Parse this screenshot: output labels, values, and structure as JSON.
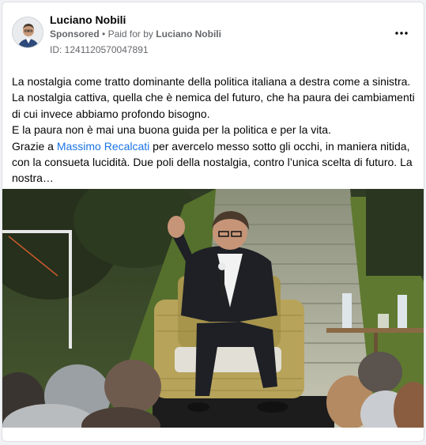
{
  "post": {
    "author": "Luciano Nobili",
    "sponsored_label": "Sponsored",
    "separator": "•",
    "paid_for_prefix": "Paid for by",
    "paid_for_name": "Luciano Nobili",
    "id_label": "ID: 1241120570047891",
    "more_icon": "more-dots-icon",
    "text": {
      "line1": "La nostalgia come tratto dominante della politica italiana a destra come a sinistra.",
      "line2": "La nostalgia cattiva, quella che è nemica del futuro, che ha paura dei cambiamenti di cui invece abbiamo profondo bisogno.",
      "line3": "E la paura non è mai una buona guida per la politica e per la vita.",
      "line4_before": "Grazie a ",
      "line4_link": "Massimo Recalcati",
      "line4_after": " per avercelo messo sotto gli occhi, in maniera nitida, con la consueta lucidità. Due poli della nostalgia, contro l’unica scelta di futuro. La nostra…"
    }
  },
  "colors": {
    "link": "#1b74e4",
    "secondary_text": "#65676b",
    "primary_text": "#050505"
  }
}
